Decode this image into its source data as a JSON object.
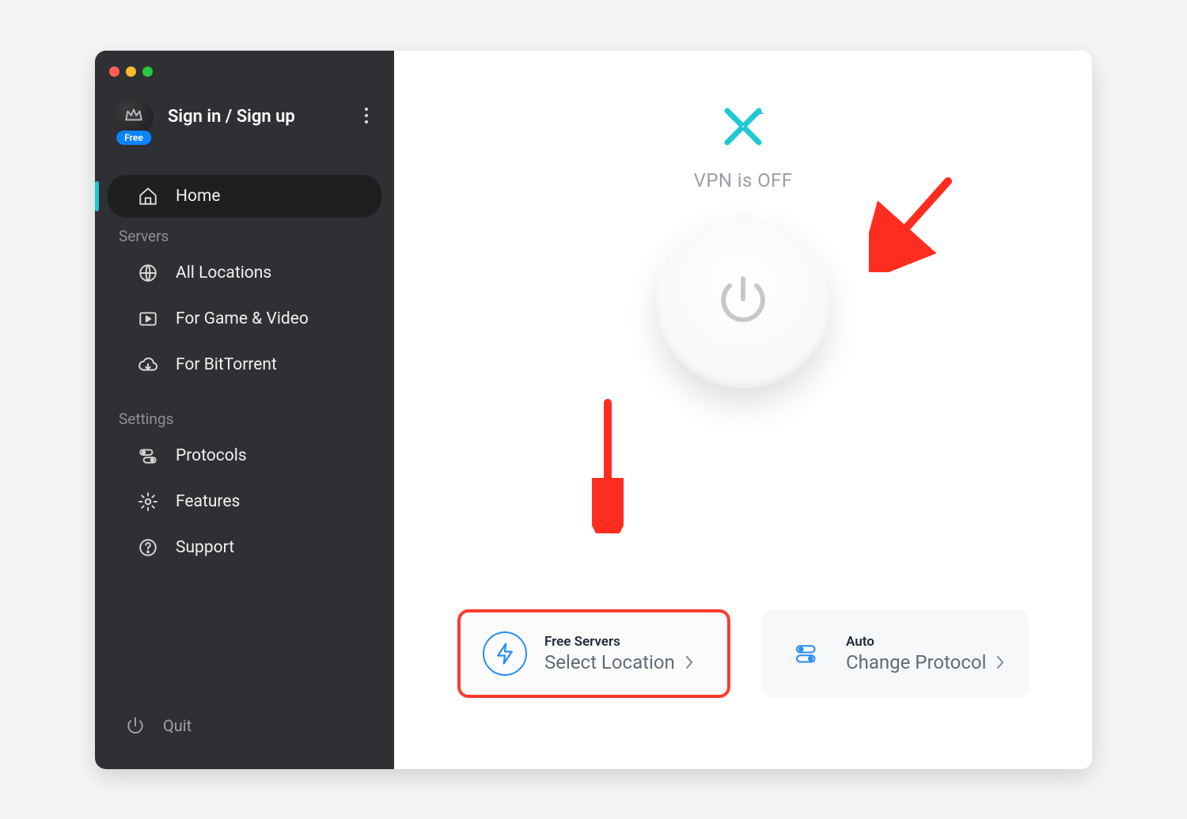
{
  "account": {
    "label": "Sign in / Sign up",
    "badge": "Free"
  },
  "sidebar": {
    "items": [
      {
        "label": "Home",
        "active": true
      },
      {
        "section": "Servers"
      },
      {
        "label": "All Locations"
      },
      {
        "label": "For Game & Video"
      },
      {
        "label": "For BitTorrent"
      },
      {
        "section": "Settings"
      },
      {
        "label": "Protocols"
      },
      {
        "label": "Features"
      },
      {
        "label": "Support"
      }
    ],
    "section_servers": "Servers",
    "section_settings": "Settings",
    "home": "Home",
    "all_locations": "All Locations",
    "game_video": "For Game & Video",
    "bittorrent": "For BitTorrent",
    "protocols": "Protocols",
    "features": "Features",
    "support": "Support",
    "quit": "Quit"
  },
  "main": {
    "status": "VPN is OFF",
    "card_servers": {
      "title": "Free Servers",
      "subtitle": "Select Location"
    },
    "card_protocol": {
      "title": "Auto",
      "subtitle": "Change Protocol"
    }
  },
  "colors": {
    "accent": "#1fc8d4",
    "blue": "#2a8df2",
    "annotation": "#ff3b30"
  }
}
